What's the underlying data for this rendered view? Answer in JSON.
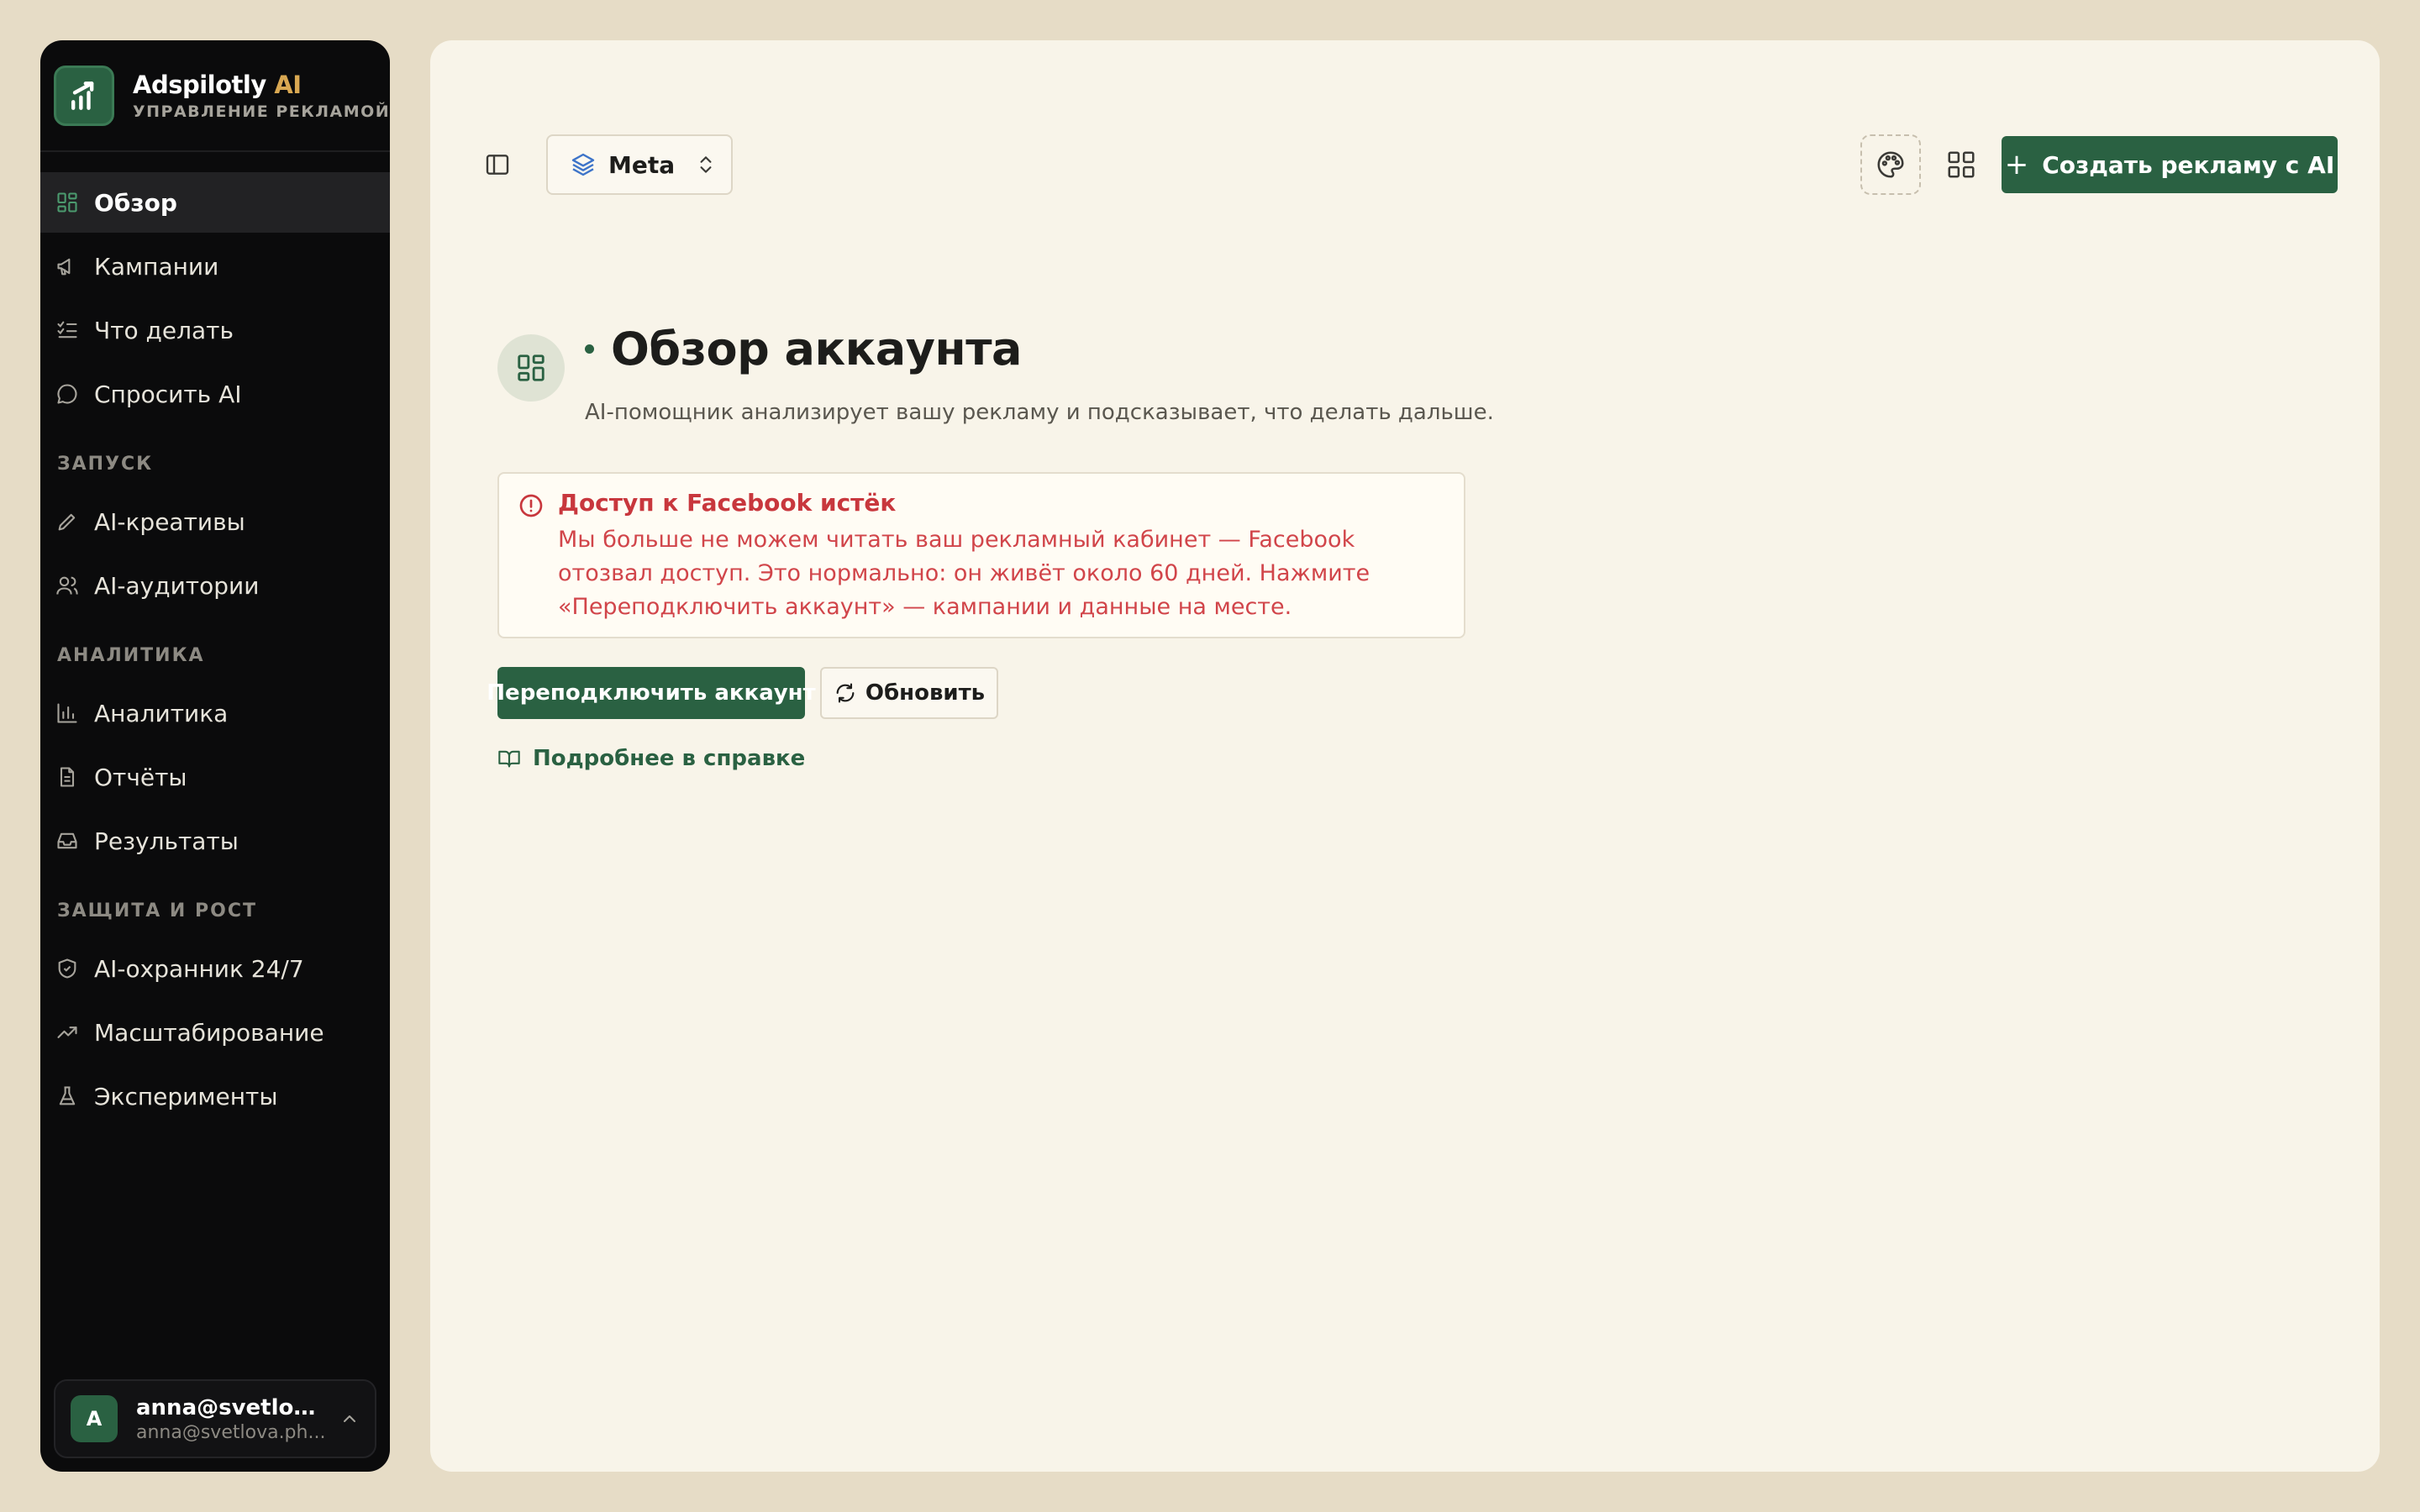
{
  "brand": {
    "name": "Adspilotly",
    "name_ai": "AI",
    "subtitle": "УПРАВЛЕНИЕ РЕКЛАМОЙ",
    "logo_icon": "chart-up-icon"
  },
  "sidebar": {
    "main_items": [
      {
        "label": "Обзор",
        "icon": "grid-icon",
        "active": true
      },
      {
        "label": "Кампании",
        "icon": "megaphone-icon"
      },
      {
        "label": "Что делать",
        "icon": "checklist-icon"
      },
      {
        "label": "Спросить AI",
        "icon": "chat-icon"
      }
    ],
    "sections": [
      {
        "label": "ЗАПУСК",
        "items": [
          {
            "label": "AI-креативы",
            "icon": "pencil-icon"
          },
          {
            "label": "AI-аудитории",
            "icon": "users-icon"
          }
        ]
      },
      {
        "label": "АНАЛИТИКА",
        "items": [
          {
            "label": "Аналитика",
            "icon": "bar-chart-icon"
          },
          {
            "label": "Отчёты",
            "icon": "file-icon"
          },
          {
            "label": "Результаты",
            "icon": "inbox-icon"
          }
        ]
      },
      {
        "label": "ЗАЩИТА И РОСТ",
        "items": [
          {
            "label": "AI-охранник 24/7",
            "icon": "shield-icon"
          },
          {
            "label": "Масштабирование",
            "icon": "trending-up-icon"
          },
          {
            "label": "Эксперименты",
            "icon": "flask-icon"
          }
        ]
      }
    ],
    "user": {
      "initial": "A",
      "name": "anna@svetlova...",
      "email": "anna@svetlova.ph..."
    }
  },
  "toolbar": {
    "platform": "Meta",
    "create_label": "Создать рекламу с AI"
  },
  "page": {
    "title": "Обзор аккаунта",
    "subtitle": "AI-помощник анализирует вашу рекламу и подсказывает, что делать дальше."
  },
  "alert": {
    "title": "Доступ к Facebook истёк",
    "body": "Мы больше не можем читать ваш рекламный кабинет — Facebook отозвал доступ. Это нормально: он живёт около 60 дней. Нажмите «Переподключить аккаунт» — кампании и данные на месте."
  },
  "actions": {
    "reconnect_label": "Переподключить аккаунт",
    "refresh_label": "Обновить",
    "help_label": "Подробнее в справке"
  },
  "colors": {
    "accent": "#2a6142",
    "error": "#c8373d",
    "brand_ai": "#d9a852",
    "sidebar_bg": "#0b0b0c",
    "page_bg": "#f8f4e9"
  }
}
